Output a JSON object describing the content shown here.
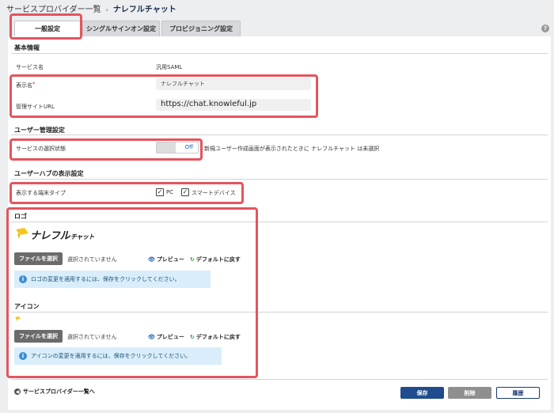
{
  "breadcrumb": {
    "parent": "サービスプロバイダー一覧",
    "separator": "›",
    "current": "ナレフルチャット"
  },
  "tabs": [
    {
      "label": "一般設定",
      "active": true
    },
    {
      "label": "シングルサインオン設定",
      "active": false
    },
    {
      "label": "プロビジョニング設定",
      "active": false
    }
  ],
  "help": {
    "label": "?"
  },
  "basic": {
    "title": "基本情報",
    "service_name_label": "サービス名",
    "service_name_value": "汎用SAML",
    "display_name_label": "表示名",
    "required_mark": "*",
    "display_name_value": "ナレフルチャット",
    "admin_url_label": "管理サイトURL",
    "admin_url_value": "https://chat.knowleful.jp"
  },
  "user_mgmt": {
    "title": "ユーザー管理設定",
    "selection_label": "サービスの選択状態",
    "toggle_label": "Off",
    "toggle_on": false,
    "note": "新規ユーザー作成画面が表示されたときに ナレフルチャット は未選択"
  },
  "user_hub": {
    "title": "ユーザーハブの表示設定",
    "device_label": "表示する端末タイプ",
    "options": [
      {
        "label": "PC",
        "checked": true
      },
      {
        "label": "スマートデバイス",
        "checked": true
      }
    ]
  },
  "logo_section": {
    "title": "ロゴ",
    "logo_text": "ナレフル",
    "logo_subtext": "チャット",
    "file_button": "ファイルを選択",
    "no_file": "選択されていません",
    "preview": "プレビュー",
    "default": "デフォルトに戻す",
    "info": "ロゴの変更を適用するには、保存をクリックしてください。"
  },
  "icon_section": {
    "title": "アイコン",
    "file_button": "ファイルを選択",
    "no_file": "選択されていません",
    "preview": "プレビュー",
    "default": "デフォルトに戻す",
    "info": "アイコンの変更を適用するには、保存をクリックしてください。"
  },
  "footer": {
    "back_link": "サービスプロバイダー一覧へ",
    "save": "保存",
    "delete": "削除",
    "history": "履歴"
  },
  "colors": {
    "highlight": "#e4555e",
    "save_button": "#1f4c8c",
    "info_bg": "#d9eefa",
    "logo_yellow": "#f5c518"
  },
  "icons": [
    "eye-icon",
    "reset-icon",
    "info-icon",
    "back-arrow-icon",
    "checkmark-icon",
    "logo-mark-icon"
  ]
}
